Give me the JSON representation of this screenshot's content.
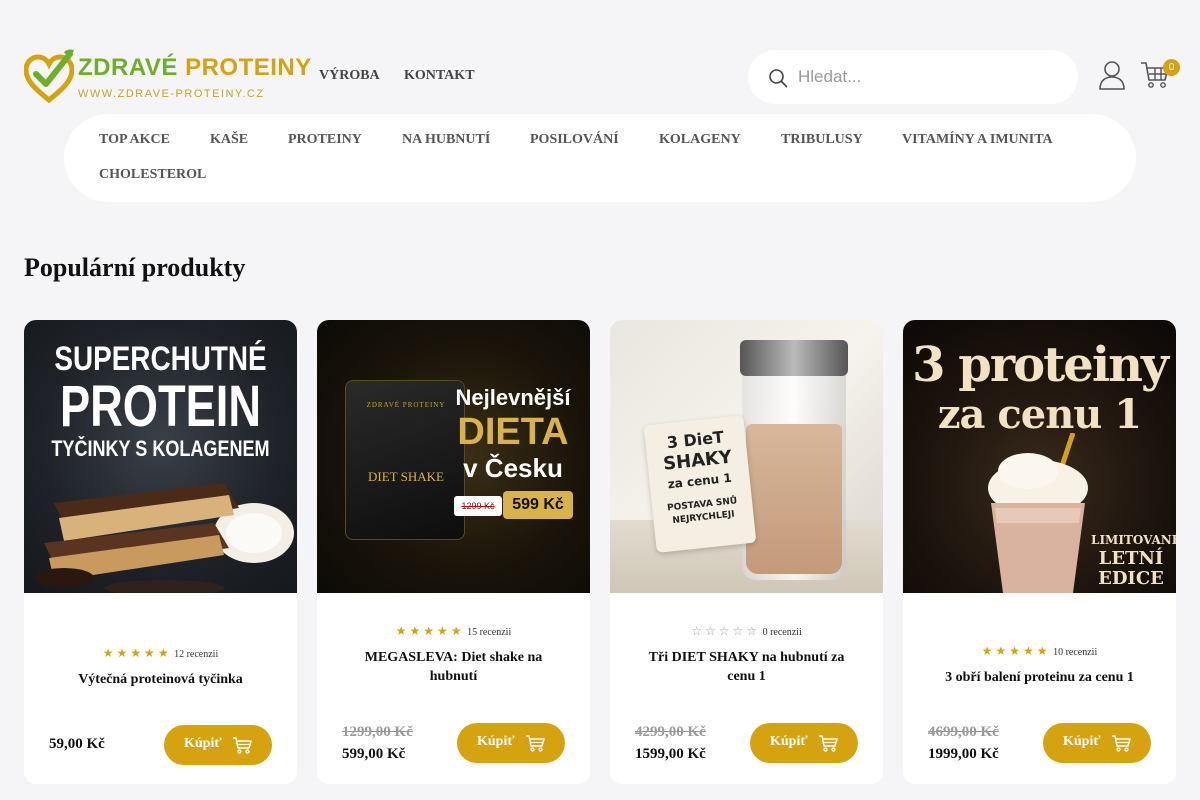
{
  "brand": {
    "name_part1": "ZDRAVÉ",
    "name_part2": "PROTEINY",
    "url": "WWW.ZDRAVE-PROTEINY.CZ"
  },
  "topnav": {
    "vyroba": "VÝROBA",
    "kontakt": "KONTAKT"
  },
  "search": {
    "placeholder": "Hledat..."
  },
  "cart": {
    "count": "0"
  },
  "categories": [
    "TOP AKCE",
    "KAŠE",
    "PROTEINY",
    "NA HUBNUTÍ",
    "POSILOVÁNÍ",
    "KOLAGENY",
    "TRIBULUSY",
    "VITAMÍNY A IMUNITA",
    "CHOLESTEROL"
  ],
  "section_title": "Populární produkty",
  "products": [
    {
      "name": "Výtečná proteinová tyčinka",
      "rating": 4.5,
      "reviews": "12 recenzii",
      "old_price": "",
      "price": "59,00 Kč",
      "buy_label": "Kúpiť",
      "image_text": {
        "line1": "SUPERCHUTNÉ",
        "line2": "PROTEIN",
        "line3": "TYČINKY S KOLAGENEM"
      }
    },
    {
      "name": "MEGASLEVA: Diet shake na hubnutí",
      "rating": 5,
      "reviews": "15 recenzii",
      "old_price": "1299,00 Kč",
      "price": "599,00 Kč",
      "buy_label": "Kúpiť",
      "image_text": {
        "line1": "Nejlevnější",
        "line2": "DIETA",
        "line3": "v Česku",
        "old": "1299 Kč",
        "new": "599 Kč",
        "pack": "DIET SHAKE",
        "pack_brand": "ZDRAVÉ PROTEINY"
      }
    },
    {
      "name": "Tři DIET SHAKY na hubnutí za cenu 1",
      "rating": 0,
      "reviews": "0 recenzii",
      "old_price": "4299,00 Kč",
      "price": "1599,00 Kč",
      "buy_label": "Kúpiť",
      "image_text": {
        "line1": "3 DieT",
        "line2": "SHAKY",
        "line3": "za cenu 1",
        "line4": "POSTAVA SNŮ",
        "line5": "NEJRYCHLEJI"
      }
    },
    {
      "name": "3 obří balení proteinu za cenu 1",
      "rating": 4.5,
      "reviews": "10 recenzii",
      "old_price": "4699,00 Kč",
      "price": "1999,00 Kč",
      "buy_label": "Kúpiť",
      "image_text": {
        "line1": "3 proteiny",
        "line2": "za cenu 1",
        "line3": "LIMITOVANÉ",
        "line4": "LETNÍ",
        "line5": "EDICE"
      }
    }
  ],
  "colors": {
    "accent": "#d4a30f",
    "brand_green": "#6fae2a",
    "background": "#f5f5f7"
  }
}
